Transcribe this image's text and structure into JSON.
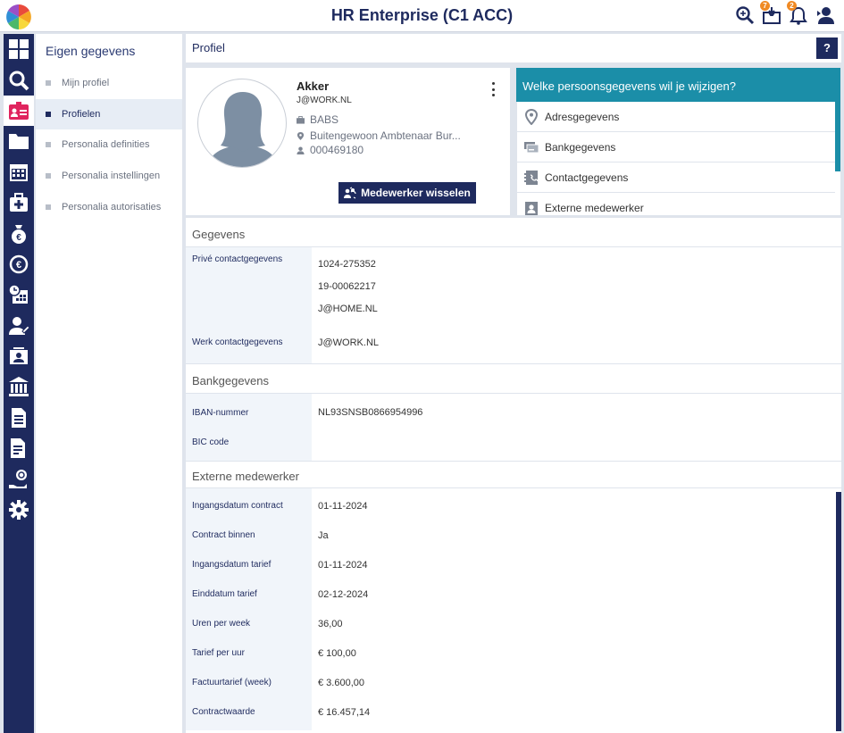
{
  "app": {
    "title": "HR Enterprise (C1 ACC)"
  },
  "topbar": {
    "notifications_badge_1": "7",
    "notifications_badge_2": "2"
  },
  "subnav": {
    "title": "Eigen gegevens",
    "items": [
      {
        "label": "Mijn profiel"
      },
      {
        "label": "Profielen"
      },
      {
        "label": "Personalia definities"
      },
      {
        "label": "Personalia instellingen"
      },
      {
        "label": "Personalia autorisaties"
      }
    ]
  },
  "header": {
    "title": "Profiel",
    "help_label": "?"
  },
  "profile": {
    "name": "Akker",
    "email": "J@WORK.NL",
    "department": "BABS",
    "location": "Buitengewoon Ambtenaar Bur...",
    "employee_id": "000469180",
    "switch_button": "Medewerker wisselen"
  },
  "change_panel": {
    "title": "Welke persoonsgegevens wil je wijzigen?",
    "items": [
      {
        "label": "Adresgegevens"
      },
      {
        "label": "Bankgegevens"
      },
      {
        "label": "Contactgegevens"
      },
      {
        "label": "Externe medewerker"
      }
    ]
  },
  "gegevens": {
    "title": "Gegevens",
    "prive_label": "Privé contactgegevens",
    "prive_values": [
      "1024-275352",
      "19-00062217",
      "J@HOME.NL"
    ],
    "werk_label": "Werk contactgegevens",
    "werk_value": "J@WORK.NL"
  },
  "bank": {
    "title": "Bankgegevens",
    "rows": [
      {
        "label": "IBAN-nummer",
        "value": "NL93SNSB0866954996"
      },
      {
        "label": "BIC code",
        "value": ""
      }
    ]
  },
  "extern": {
    "title": "Externe medewerker",
    "rows": [
      {
        "label": "Ingangsdatum contract",
        "value": "01-11-2024"
      },
      {
        "label": "Contract binnen",
        "value": "Ja"
      },
      {
        "label": "Ingangsdatum tarief",
        "value": "01-11-2024"
      },
      {
        "label": "Einddatum tarief",
        "value": "02-12-2024"
      },
      {
        "label": "Uren per week",
        "value": "36,00"
      },
      {
        "label": "Tarief per uur",
        "value": "€ 100,00"
      },
      {
        "label": "Factuurtarief (week)",
        "value": "€ 3.600,00"
      },
      {
        "label": "Contractwaarde",
        "value": "€ 16.457,14"
      }
    ]
  },
  "colors": {
    "navy": "#1e2a5e",
    "teal": "#1b8ea8",
    "badge": "#f08a24"
  }
}
